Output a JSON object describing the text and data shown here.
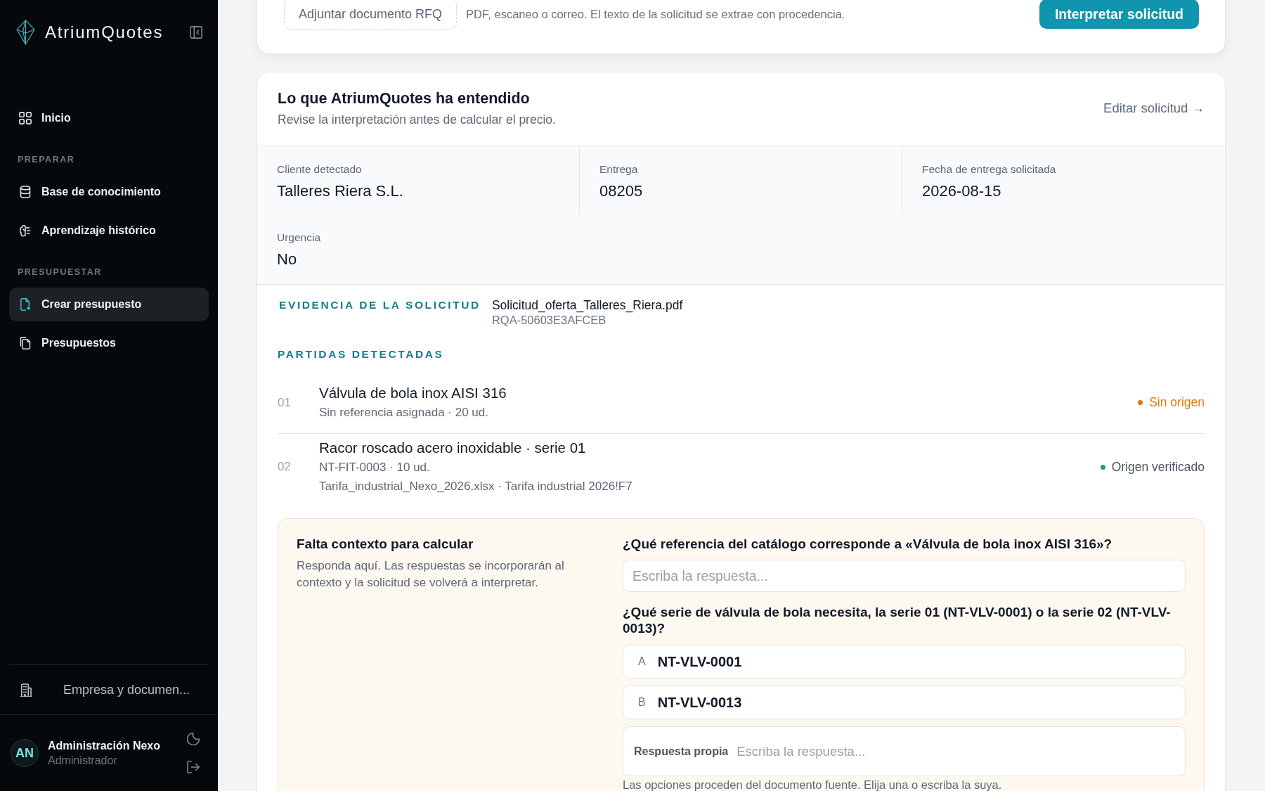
{
  "sidebar": {
    "brand": "AtriumQuotes",
    "top_items": [
      {
        "label": "Inicio",
        "selected": false
      }
    ],
    "sections": [
      {
        "title": "PREPARAR",
        "items": [
          {
            "label": "Base de conocimiento",
            "selected": false
          },
          {
            "label": "Aprendizaje histórico",
            "selected": false
          }
        ]
      },
      {
        "title": "PRESUPUESTAR",
        "items": [
          {
            "label": "Crear presupuesto",
            "selected": true
          },
          {
            "label": "Presupuestos",
            "selected": false
          }
        ]
      }
    ],
    "footer_item": {
      "label": "Empresa y documen..."
    },
    "user": {
      "initials": "AN",
      "name": "Administración Nexo",
      "role": "Administrador"
    }
  },
  "upload_card": {
    "attach_button": "Adjuntar documento RFQ",
    "hint": "PDF, escaneo o correo. El texto de la solicitud se extrae con procedencia.",
    "submit_button": "Interpretar solicitud"
  },
  "interpretation": {
    "title": "Lo que AtriumQuotes ha entendido",
    "subtitle": "Revise la interpretación antes de calcular el precio.",
    "edit_link": "Editar solicitud →",
    "facts": [
      {
        "label": "Cliente detectado",
        "value": "Talleres Riera S.L."
      },
      {
        "label": "Entrega",
        "value": "08205"
      },
      {
        "label": "Fecha de entrega solicitada",
        "value": "2026-08-15"
      },
      {
        "label": "Urgencia",
        "value": "No"
      }
    ],
    "evidence": {
      "heading": "EVIDENCIA DE LA SOLICITUD",
      "file": "Solicitud_oferta_Talleres_Riera.pdf",
      "reference": "RQA-50603E3AFCEB"
    },
    "line_items": {
      "heading": "PARTIDAS DETECTADAS",
      "items": [
        {
          "number": "01",
          "title": "Válvula de bola inox AISI 316",
          "detail": "Sin referencia asignada · 20 ud.",
          "status": {
            "kind": "missing",
            "label": "Sin origen",
            "color": "#dd7a0b"
          }
        },
        {
          "number": "02",
          "title": "Racor roscado acero inoxidable · serie 01",
          "detail": "NT-FIT-0003 · 10 ud.",
          "source": "Tarifa_industrial_Nexo_2026.xlsx · Tarifa industrial 2026!F7",
          "status": {
            "kind": "verified",
            "label": "Origen verificado",
            "color": "#1fa35a"
          }
        }
      ]
    },
    "missing_context": {
      "title": "Falta contexto para calcular",
      "description": "Responda aquí. Las respuestas se incorporarán al contexto y la solicitud se volverá a interpretar.",
      "questions": [
        {
          "kind": "text",
          "question": "¿Qué referencia del catálogo corresponde a «Válvula de bola inox AISI 316»?",
          "placeholder": "Escriba la respuesta..."
        },
        {
          "kind": "choice",
          "question": "¿Qué serie de válvula de bola necesita, la serie 01 (NT-VLV-0001) o la serie 02 (NT-VLV-0013)?",
          "options": [
            {
              "letter": "A",
              "value": "NT-VLV-0001",
              "selected": false
            },
            {
              "letter": "B",
              "value": "NT-VLV-0013",
              "selected": false
            }
          ],
          "own_answer": {
            "label": "Respuesta propia",
            "placeholder": "Escriba la respuesta..."
          },
          "note": "Las opciones proceden del documento fuente. Elija una o escriba la suya."
        }
      ]
    }
  }
}
